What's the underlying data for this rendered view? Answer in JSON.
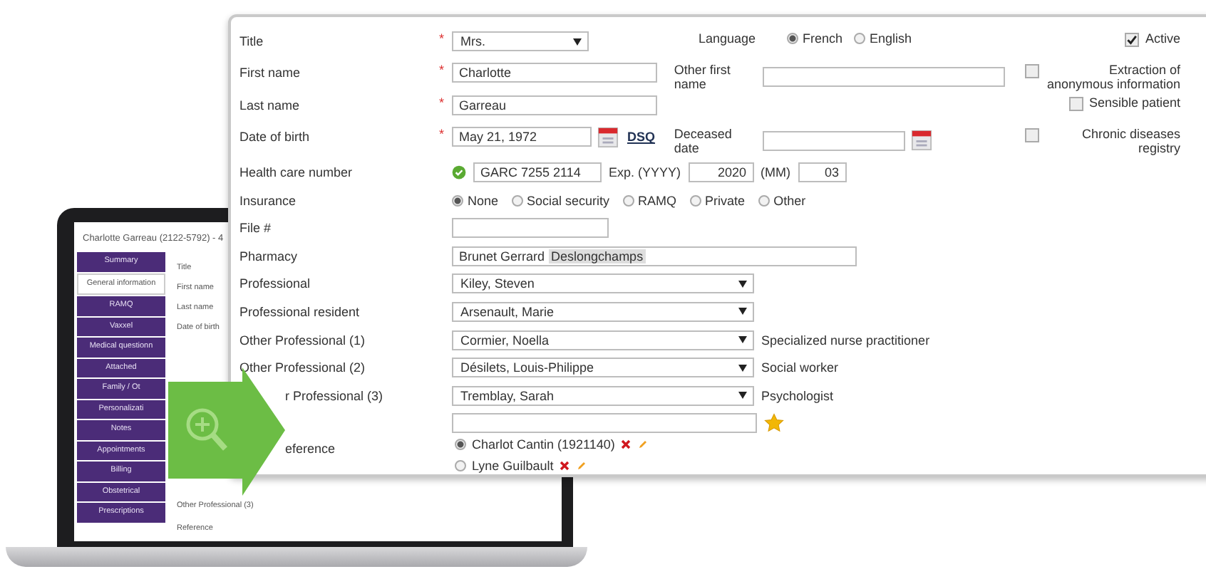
{
  "laptop": {
    "header": "Charlotte Garreau (2122-5792) - 4",
    "sidebar": [
      {
        "label": "Summary",
        "selected": false
      },
      {
        "label": "General information",
        "selected": true
      },
      {
        "label": "RAMQ",
        "selected": false
      },
      {
        "label": "Vaxxel",
        "selected": false
      },
      {
        "label": "Medical questionn",
        "selected": false
      },
      {
        "label": "Attached",
        "selected": false
      },
      {
        "label": "Family / Ot",
        "selected": false
      },
      {
        "label": "Personalizati",
        "selected": false
      },
      {
        "label": "Notes",
        "selected": false
      },
      {
        "label": "Appointments",
        "selected": false
      },
      {
        "label": "Billing",
        "selected": false
      },
      {
        "label": "Obstetrical",
        "selected": false
      },
      {
        "label": "Prescriptions",
        "selected": false
      }
    ],
    "upper_labels": [
      "Title",
      "First name",
      "Last name",
      "Date of birth"
    ],
    "lower_labels": [
      "Other Professional (3)",
      "Reference"
    ]
  },
  "form": {
    "top_rows": [
      {
        "label": "Title",
        "required_mark": "*",
        "field": {
          "kind": "select",
          "value": "Mrs."
        },
        "side_label": "Language",
        "side": {
          "kind": "radios",
          "options": [
            {
              "label": "French",
              "selected": true
            },
            {
              "label": "English",
              "selected": false
            }
          ]
        },
        "flag": {
          "label": "Active",
          "checked": true
        }
      },
      {
        "label": "First name",
        "required_mark": "*",
        "field": {
          "kind": "text",
          "value": "Charlotte"
        },
        "side_label": "Other first name",
        "side": {
          "kind": "text"
        },
        "flag": {
          "label": "Extraction of anonymous information",
          "checked": false
        }
      },
      {
        "label": "Last name",
        "required_mark": "*",
        "field": {
          "kind": "text",
          "value": "Garreau"
        },
        "flag": {
          "label": "Sensible patient",
          "checked": false
        }
      },
      {
        "label": "Date of birth",
        "required_mark": "*",
        "field": {
          "kind": "date",
          "value": "May 21, 1972",
          "link": "DSQ"
        },
        "side_label": "Deceased date",
        "side": {
          "kind": "date"
        },
        "flag": {
          "label": "Chronic diseases registry",
          "checked": false
        }
      }
    ],
    "rows": [
      {
        "label": "Health care number",
        "kind": "health",
        "verified": true,
        "number": "GARC 7255 2114",
        "exp_label": "Exp. (YYYY)",
        "year": "2020",
        "month_label": "(MM)",
        "month": "03"
      },
      {
        "label": "Insurance",
        "kind": "radios",
        "options": [
          {
            "label": "None",
            "selected": true
          },
          {
            "label": "Social security",
            "selected": false
          },
          {
            "label": "RAMQ",
            "selected": false
          },
          {
            "label": "Private",
            "selected": false
          },
          {
            "label": "Other",
            "selected": false
          }
        ]
      },
      {
        "label": "File #",
        "kind": "short_text"
      },
      {
        "label": "Pharmacy",
        "kind": "pharmacy",
        "value": "Brunet Gerrard",
        "token": "Deslongchamps"
      },
      {
        "label": "Professional",
        "kind": "select",
        "value": "Kiley, Steven"
      },
      {
        "label": "Professional resident",
        "kind": "select",
        "value": "Arsenault, Marie"
      },
      {
        "label": "Other Professional (1)",
        "kind": "select",
        "value": "Cormier, Noella",
        "note": "Specialized nurse practitioner"
      },
      {
        "label": "Other Professional (2)",
        "kind": "select",
        "value": "Désilets, Louis-Philippe",
        "note": "Social worker"
      },
      {
        "label": "r Professional (3)",
        "kind": "select",
        "value": "Tremblay, Sarah",
        "note": "Psychologist",
        "covered": true
      },
      {
        "label": "eference",
        "kind": "reference",
        "covered": true,
        "entries": [
          {
            "name": "Charlot Cantin (1921140)",
            "selected": true
          },
          {
            "name": "Lyne Guilbault",
            "selected": false
          }
        ]
      }
    ]
  }
}
